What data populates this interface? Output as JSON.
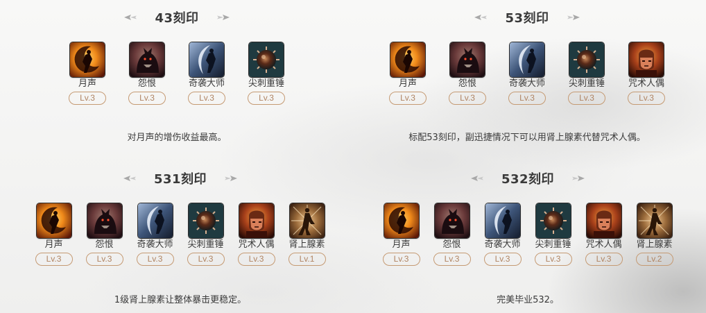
{
  "sections": [
    {
      "title": "43刻印",
      "items": [
        {
          "name": "月声",
          "level": "Lv.3",
          "icon": "moonlight-sound-icon"
        },
        {
          "name": "怨恨",
          "level": "Lv.3",
          "icon": "grudge-icon"
        },
        {
          "name": "奇袭大师",
          "level": "Lv.3",
          "icon": "master-ambusher-icon"
        },
        {
          "name": "尖刺重锤",
          "level": "Lv.3",
          "icon": "keen-blunt-weapon-icon"
        }
      ],
      "note": "对月声的增伤收益最高。"
    },
    {
      "title": "53刻印",
      "items": [
        {
          "name": "月声",
          "level": "Lv.3",
          "icon": "moonlight-sound-icon"
        },
        {
          "name": "怨恨",
          "level": "Lv.3",
          "icon": "grudge-icon"
        },
        {
          "name": "奇袭大师",
          "level": "Lv.3",
          "icon": "master-ambusher-icon"
        },
        {
          "name": "尖刺重锤",
          "level": "Lv.3",
          "icon": "keen-blunt-weapon-icon"
        },
        {
          "name": "咒术人偶",
          "level": "Lv.3",
          "icon": "cursed-doll-icon"
        }
      ],
      "note": "标配53刻印，副迅捷情况下可以用肾上腺素代替咒术人偶。"
    },
    {
      "title": "531刻印",
      "items": [
        {
          "name": "月声",
          "level": "Lv.3",
          "icon": "moonlight-sound-icon"
        },
        {
          "name": "怨恨",
          "level": "Lv.3",
          "icon": "grudge-icon"
        },
        {
          "name": "奇袭大师",
          "level": "Lv.3",
          "icon": "master-ambusher-icon"
        },
        {
          "name": "尖刺重锤",
          "level": "Lv.3",
          "icon": "keen-blunt-weapon-icon"
        },
        {
          "name": "咒术人偶",
          "level": "Lv.3",
          "icon": "cursed-doll-icon"
        },
        {
          "name": "肾上腺素",
          "level": "Lv.1",
          "icon": "adrenaline-icon"
        }
      ],
      "note": "1级肾上腺素让整体暴击更稳定。"
    },
    {
      "title": "532刻印",
      "items": [
        {
          "name": "月声",
          "level": "Lv.3",
          "icon": "moonlight-sound-icon"
        },
        {
          "name": "怨恨",
          "level": "Lv.3",
          "icon": "grudge-icon"
        },
        {
          "name": "奇袭大师",
          "level": "Lv.3",
          "icon": "master-ambusher-icon"
        },
        {
          "name": "尖刺重锤",
          "level": "Lv.3",
          "icon": "keen-blunt-weapon-icon"
        },
        {
          "name": "咒术人偶",
          "level": "Lv.3",
          "icon": "cursed-doll-icon"
        },
        {
          "name": "肾上腺素",
          "level": "Lv.2",
          "icon": "adrenaline-icon"
        }
      ],
      "note": "完美毕业532。"
    }
  ],
  "colors": {
    "title_text": "#3a3a3a",
    "level_border": "#c59a73",
    "level_text": "#b08462"
  }
}
